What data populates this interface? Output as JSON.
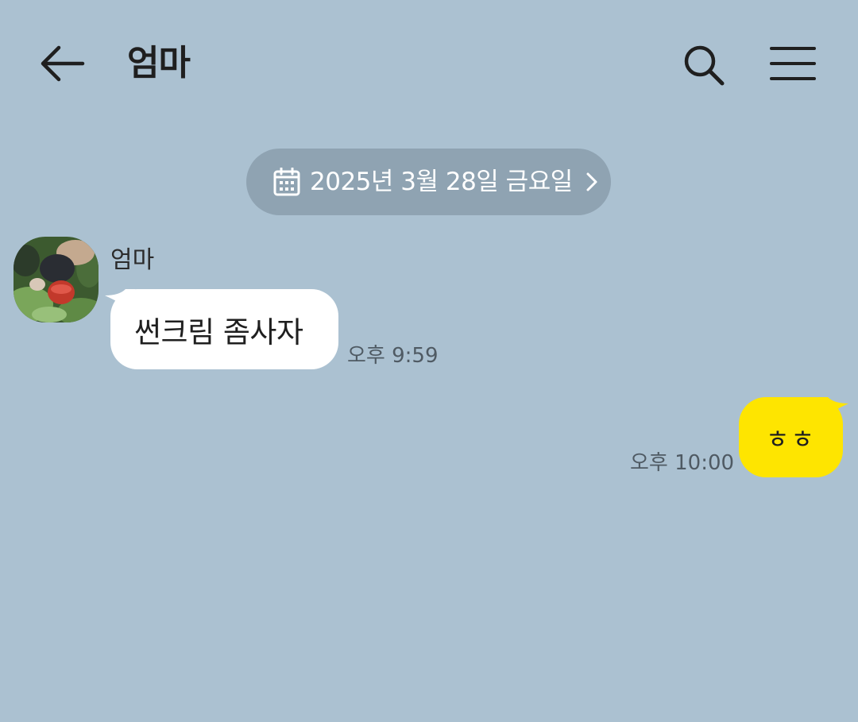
{
  "header": {
    "title": "엄마",
    "back_icon": "back-arrow-icon",
    "search_icon": "search-icon",
    "menu_icon": "menu-icon"
  },
  "date_divider": {
    "text": "2025년 3월 28일 금요일",
    "icon": "calendar-icon",
    "chevron": "chevron-right-icon"
  },
  "messages": [
    {
      "direction": "incoming",
      "sender": "엄마",
      "text": "썬크림 좀사자",
      "time": "오후 9:59"
    },
    {
      "direction": "outgoing",
      "text": "ㅎㅎ",
      "time": "오후 10:00"
    }
  ],
  "colors": {
    "background": "#abc1d1",
    "date_pill": "#8fa3b2",
    "incoming_bubble": "#ffffff",
    "outgoing_bubble": "#fee500",
    "text": "#1f1f1f",
    "time_text": "#4f5a63"
  }
}
